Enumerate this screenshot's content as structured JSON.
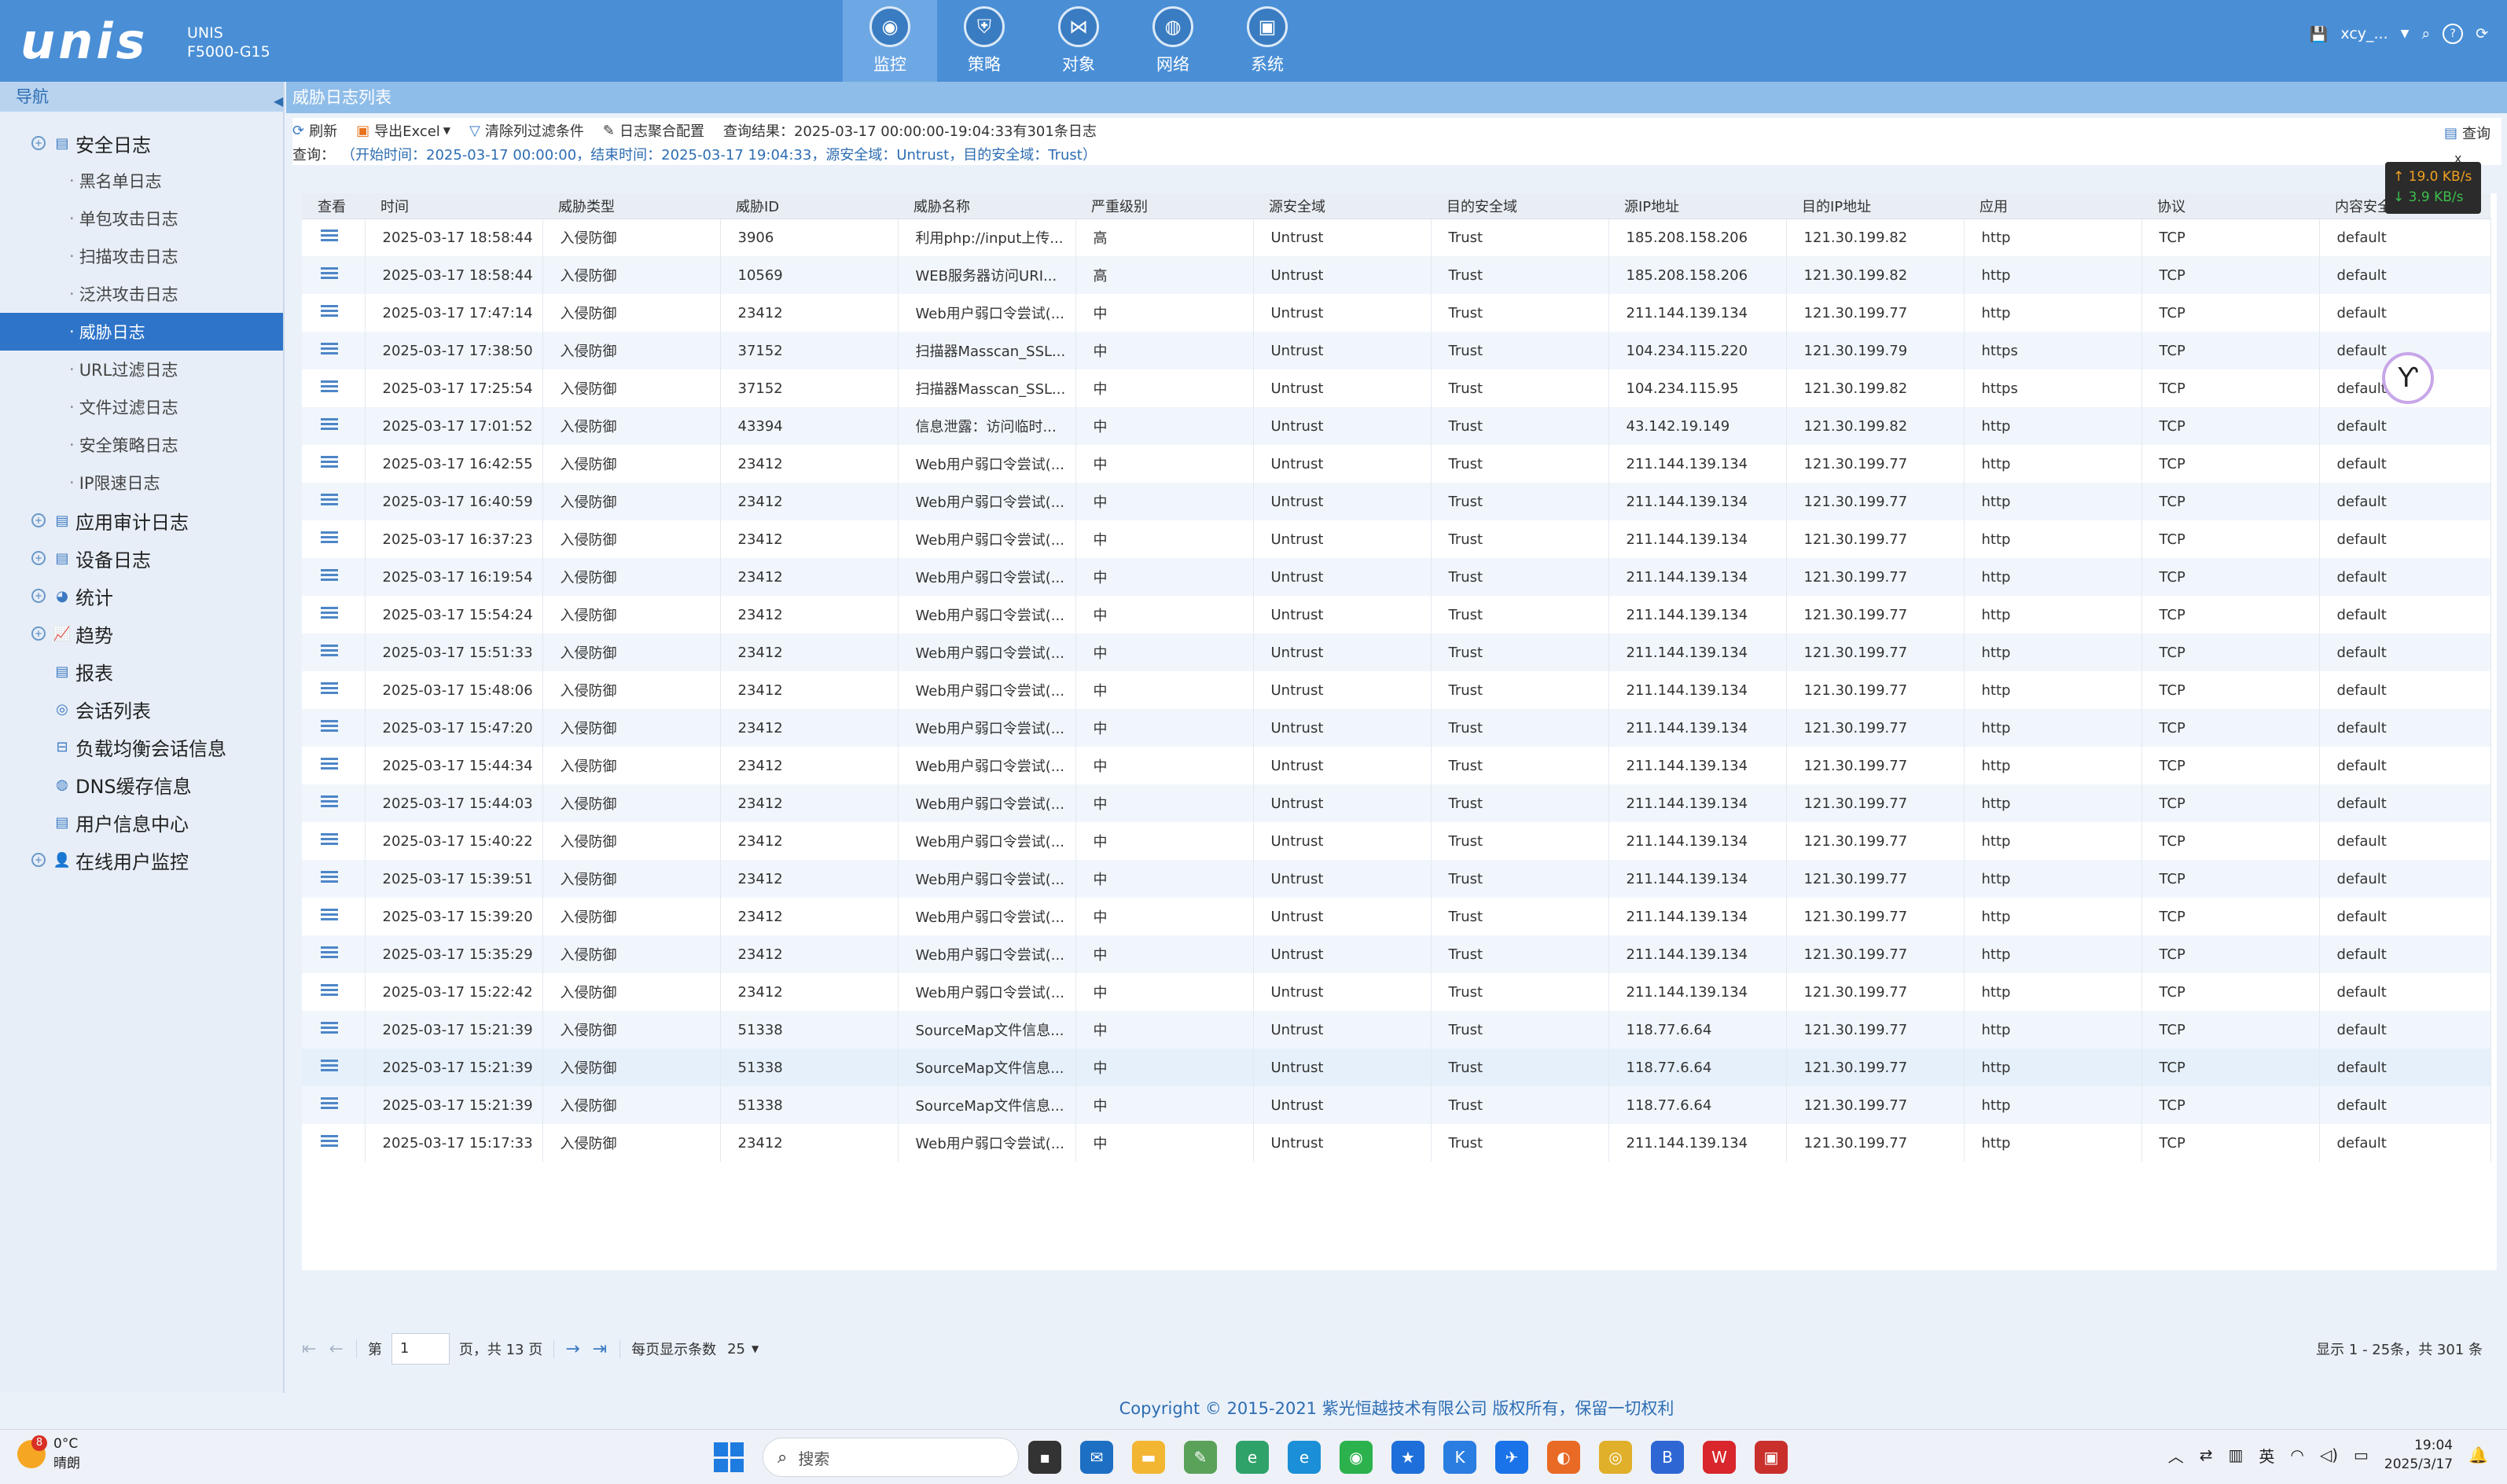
{
  "header": {
    "logo": "unis",
    "product_line1": "UNIS",
    "product_line2": "F5000-G15",
    "tabs": [
      {
        "label": "监控",
        "icon": "monitor-icon",
        "active": true
      },
      {
        "label": "策略",
        "icon": "shield-icon",
        "active": false
      },
      {
        "label": "对象",
        "icon": "share-icon",
        "active": false
      },
      {
        "label": "网络",
        "icon": "globe-icon",
        "active": false
      },
      {
        "label": "系统",
        "icon": "system-icon",
        "active": false
      }
    ],
    "user": "xcy_..."
  },
  "sidebar": {
    "title": "导航",
    "nodes": [
      {
        "label": "安全日志",
        "expandable": true,
        "icon": "doc-icon"
      },
      {
        "label": "黑名单日志",
        "child": true
      },
      {
        "label": "单包攻击日志",
        "child": true
      },
      {
        "label": "扫描攻击日志",
        "child": true
      },
      {
        "label": "泛洪攻击日志",
        "child": true
      },
      {
        "label": "威胁日志",
        "child": true,
        "active": true
      },
      {
        "label": "URL过滤日志",
        "child": true
      },
      {
        "label": "文件过滤日志",
        "child": true
      },
      {
        "label": "安全策略日志",
        "child": true
      },
      {
        "label": "IP限速日志",
        "child": true
      },
      {
        "label": "应用审计日志",
        "expandable": true,
        "icon": "doc-icon"
      },
      {
        "label": "设备日志",
        "expandable": true,
        "icon": "doc-icon"
      },
      {
        "label": "统计",
        "expandable": true,
        "icon": "pie-icon"
      },
      {
        "label": "趋势",
        "expandable": true,
        "icon": "trend-icon"
      },
      {
        "label": "报表",
        "expandable": false,
        "icon": "report-icon"
      },
      {
        "label": "会话列表",
        "expandable": false,
        "icon": "session-icon"
      },
      {
        "label": "负载均衡会话信息",
        "expandable": false,
        "icon": "balance-icon"
      },
      {
        "label": "DNS缓存信息",
        "expandable": false,
        "icon": "dns-icon"
      },
      {
        "label": "用户信息中心",
        "expandable": false,
        "icon": "user-doc-icon"
      },
      {
        "label": "在线用户监控",
        "expandable": true,
        "icon": "user-icon"
      }
    ]
  },
  "panel": {
    "title": "威胁日志列表",
    "toolbar": {
      "refresh": "刷新",
      "export": "导出Excel",
      "clear_filter": "清除列过滤条件",
      "aggregate": "日志聚合配置",
      "result": "查询结果：2025-03-17 00:00:00-19:04:33有301条日志",
      "query_button": "查询"
    },
    "query_label": "查询：",
    "query_conditions": "（开始时间：2025-03-17 00:00:00，结束时间：2025-03-17 19:04:33，源安全域：Untrust，目的安全域：Trust）"
  },
  "net_speed": {
    "up": "↑ 19.0 KB/s",
    "down": "↓ 3.9 KB/s",
    "close": "x"
  },
  "table": {
    "columns": [
      "查看",
      "时间",
      "威胁类型",
      "威胁ID",
      "威胁名称",
      "严重级别",
      "源安全域",
      "目的安全域",
      "源IP地址",
      "目的IP地址",
      "应用",
      "协议",
      "内容安全"
    ],
    "rows": [
      [
        "2025-03-17 18:58:44",
        "入侵防御",
        "3906",
        "利用php://input上传...",
        "高",
        "Untrust",
        "Trust",
        "185.208.158.206",
        "121.30.199.82",
        "http",
        "TCP",
        "default"
      ],
      [
        "2025-03-17 18:58:44",
        "入侵防御",
        "10569",
        "WEB服务器访问URI...",
        "高",
        "Untrust",
        "Trust",
        "185.208.158.206",
        "121.30.199.82",
        "http",
        "TCP",
        "default"
      ],
      [
        "2025-03-17 17:47:14",
        "入侵防御",
        "23412",
        "Web用户弱口令尝试(...",
        "中",
        "Untrust",
        "Trust",
        "211.144.139.134",
        "121.30.199.77",
        "http",
        "TCP",
        "default"
      ],
      [
        "2025-03-17 17:38:50",
        "入侵防御",
        "37152",
        "扫描器Masscan_SSL...",
        "中",
        "Untrust",
        "Trust",
        "104.234.115.220",
        "121.30.199.79",
        "https",
        "TCP",
        "default"
      ],
      [
        "2025-03-17 17:25:54",
        "入侵防御",
        "37152",
        "扫描器Masscan_SSL...",
        "中",
        "Untrust",
        "Trust",
        "104.234.115.95",
        "121.30.199.82",
        "https",
        "TCP",
        "default"
      ],
      [
        "2025-03-17 17:01:52",
        "入侵防御",
        "43394",
        "信息泄露：访问临时...",
        "中",
        "Untrust",
        "Trust",
        "43.142.19.149",
        "121.30.199.82",
        "http",
        "TCP",
        "default"
      ],
      [
        "2025-03-17 16:42:55",
        "入侵防御",
        "23412",
        "Web用户弱口令尝试(...",
        "中",
        "Untrust",
        "Trust",
        "211.144.139.134",
        "121.30.199.77",
        "http",
        "TCP",
        "default"
      ],
      [
        "2025-03-17 16:40:59",
        "入侵防御",
        "23412",
        "Web用户弱口令尝试(...",
        "中",
        "Untrust",
        "Trust",
        "211.144.139.134",
        "121.30.199.77",
        "http",
        "TCP",
        "default"
      ],
      [
        "2025-03-17 16:37:23",
        "入侵防御",
        "23412",
        "Web用户弱口令尝试(...",
        "中",
        "Untrust",
        "Trust",
        "211.144.139.134",
        "121.30.199.77",
        "http",
        "TCP",
        "default"
      ],
      [
        "2025-03-17 16:19:54",
        "入侵防御",
        "23412",
        "Web用户弱口令尝试(...",
        "中",
        "Untrust",
        "Trust",
        "211.144.139.134",
        "121.30.199.77",
        "http",
        "TCP",
        "default"
      ],
      [
        "2025-03-17 15:54:24",
        "入侵防御",
        "23412",
        "Web用户弱口令尝试(...",
        "中",
        "Untrust",
        "Trust",
        "211.144.139.134",
        "121.30.199.77",
        "http",
        "TCP",
        "default"
      ],
      [
        "2025-03-17 15:51:33",
        "入侵防御",
        "23412",
        "Web用户弱口令尝试(...",
        "中",
        "Untrust",
        "Trust",
        "211.144.139.134",
        "121.30.199.77",
        "http",
        "TCP",
        "default"
      ],
      [
        "2025-03-17 15:48:06",
        "入侵防御",
        "23412",
        "Web用户弱口令尝试(...",
        "中",
        "Untrust",
        "Trust",
        "211.144.139.134",
        "121.30.199.77",
        "http",
        "TCP",
        "default"
      ],
      [
        "2025-03-17 15:47:20",
        "入侵防御",
        "23412",
        "Web用户弱口令尝试(...",
        "中",
        "Untrust",
        "Trust",
        "211.144.139.134",
        "121.30.199.77",
        "http",
        "TCP",
        "default"
      ],
      [
        "2025-03-17 15:44:34",
        "入侵防御",
        "23412",
        "Web用户弱口令尝试(...",
        "中",
        "Untrust",
        "Trust",
        "211.144.139.134",
        "121.30.199.77",
        "http",
        "TCP",
        "default"
      ],
      [
        "2025-03-17 15:44:03",
        "入侵防御",
        "23412",
        "Web用户弱口令尝试(...",
        "中",
        "Untrust",
        "Trust",
        "211.144.139.134",
        "121.30.199.77",
        "http",
        "TCP",
        "default"
      ],
      [
        "2025-03-17 15:40:22",
        "入侵防御",
        "23412",
        "Web用户弱口令尝试(...",
        "中",
        "Untrust",
        "Trust",
        "211.144.139.134",
        "121.30.199.77",
        "http",
        "TCP",
        "default"
      ],
      [
        "2025-03-17 15:39:51",
        "入侵防御",
        "23412",
        "Web用户弱口令尝试(...",
        "中",
        "Untrust",
        "Trust",
        "211.144.139.134",
        "121.30.199.77",
        "http",
        "TCP",
        "default"
      ],
      [
        "2025-03-17 15:39:20",
        "入侵防御",
        "23412",
        "Web用户弱口令尝试(...",
        "中",
        "Untrust",
        "Trust",
        "211.144.139.134",
        "121.30.199.77",
        "http",
        "TCP",
        "default"
      ],
      [
        "2025-03-17 15:35:29",
        "入侵防御",
        "23412",
        "Web用户弱口令尝试(...",
        "中",
        "Untrust",
        "Trust",
        "211.144.139.134",
        "121.30.199.77",
        "http",
        "TCP",
        "default"
      ],
      [
        "2025-03-17 15:22:42",
        "入侵防御",
        "23412",
        "Web用户弱口令尝试(...",
        "中",
        "Untrust",
        "Trust",
        "211.144.139.134",
        "121.30.199.77",
        "http",
        "TCP",
        "default"
      ],
      [
        "2025-03-17 15:21:39",
        "入侵防御",
        "51338",
        "SourceMap文件信息...",
        "中",
        "Untrust",
        "Trust",
        "118.77.6.64",
        "121.30.199.77",
        "http",
        "TCP",
        "default"
      ],
      [
        "2025-03-17 15:21:39",
        "入侵防御",
        "51338",
        "SourceMap文件信息...",
        "中",
        "Untrust",
        "Trust",
        "118.77.6.64",
        "121.30.199.77",
        "http",
        "TCP",
        "default"
      ],
      [
        "2025-03-17 15:21:39",
        "入侵防御",
        "51338",
        "SourceMap文件信息...",
        "中",
        "Untrust",
        "Trust",
        "118.77.6.64",
        "121.30.199.77",
        "http",
        "TCP",
        "default"
      ],
      [
        "2025-03-17 15:17:33",
        "入侵防御",
        "23412",
        "Web用户弱口令尝试(...",
        "中",
        "Untrust",
        "Trust",
        "211.144.139.134",
        "121.30.199.77",
        "http",
        "TCP",
        "default"
      ]
    ],
    "highlighted_row": 22
  },
  "pager": {
    "page_prefix": "第",
    "current_page": "1",
    "page_suffix": "页，共 13 页",
    "per_page_label": "每页显示条数",
    "per_page_value": "25",
    "summary": "显示 1 - 25条，共 301 条"
  },
  "footer": "Copyright © 2015-2021 紫光恒越技术有限公司 版权所有，保留一切权利",
  "taskbar": {
    "weather_badge": "8",
    "temperature": "0°C",
    "weather": "晴朗",
    "search_placeholder": "搜索",
    "ime": "英",
    "time": "19:04",
    "date": "2025/3/17",
    "apps": [
      {
        "icon": "terminal-icon",
        "color": "#333333"
      },
      {
        "icon": "outlook-icon",
        "color": "#1d6fc4"
      },
      {
        "icon": "folder-icon",
        "color": "#f2b632"
      },
      {
        "icon": "paint-icon",
        "color": "#5aa15a"
      },
      {
        "icon": "edge-dev-icon",
        "color": "#2fa26a"
      },
      {
        "icon": "edge-icon",
        "color": "#1b8fd8"
      },
      {
        "icon": "wechat-icon",
        "color": "#2bb24c"
      },
      {
        "icon": "star-app-icon",
        "color": "#1e6fd9"
      },
      {
        "icon": "k-app-icon",
        "color": "#2a7de1"
      },
      {
        "icon": "feather-icon",
        "color": "#1a73e8"
      },
      {
        "icon": "firefox-icon",
        "color": "#e86a25"
      },
      {
        "icon": "chrome-icon",
        "color": "#e0b02a"
      },
      {
        "icon": "b-app-icon",
        "color": "#2e66d4"
      },
      {
        "icon": "wps-icon",
        "color": "#d8262c"
      },
      {
        "icon": "red-app-icon",
        "color": "#c9302c"
      }
    ]
  }
}
